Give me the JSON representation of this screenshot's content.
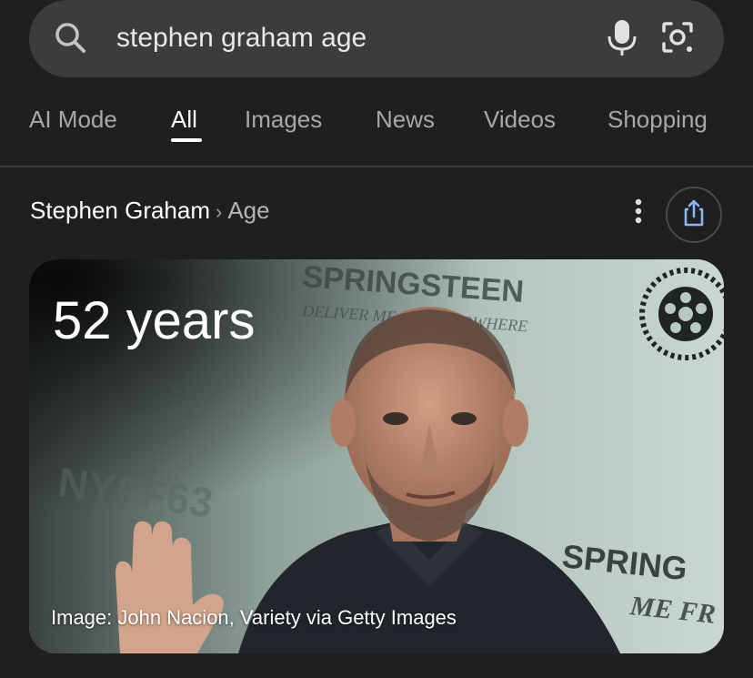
{
  "search": {
    "query": "stephen graham age",
    "icons": {
      "search": "search-icon",
      "mic": "microphone-icon",
      "lens": "camera-lens-icon"
    }
  },
  "tabs": [
    {
      "label": "AI Mode",
      "active": false
    },
    {
      "label": "All",
      "active": true
    },
    {
      "label": "Images",
      "active": false
    },
    {
      "label": "News",
      "active": false
    },
    {
      "label": "Videos",
      "active": false
    },
    {
      "label": "Shopping",
      "active": false
    }
  ],
  "breadcrumb": {
    "entity": "Stephen Graham",
    "separator": "›",
    "attribute": "Age"
  },
  "actions": {
    "more": "more-vert-icon",
    "share": "share-icon"
  },
  "answer": {
    "value": "52 years",
    "image_credit": "Image: John Nacion, Variety via Getty Images",
    "backdrop_texts": [
      "SPRINGSTEEN",
      "DELIVER ME FROM NOWHERE",
      "NYFF63",
      "SPRING",
      "ME FR"
    ]
  },
  "colors": {
    "background": "#1f1f1f",
    "search_bar": "#3c3c3e",
    "text_primary": "#ffffff",
    "text_secondary": "#a8a8a8",
    "share_icon": "#8ab4f8"
  }
}
